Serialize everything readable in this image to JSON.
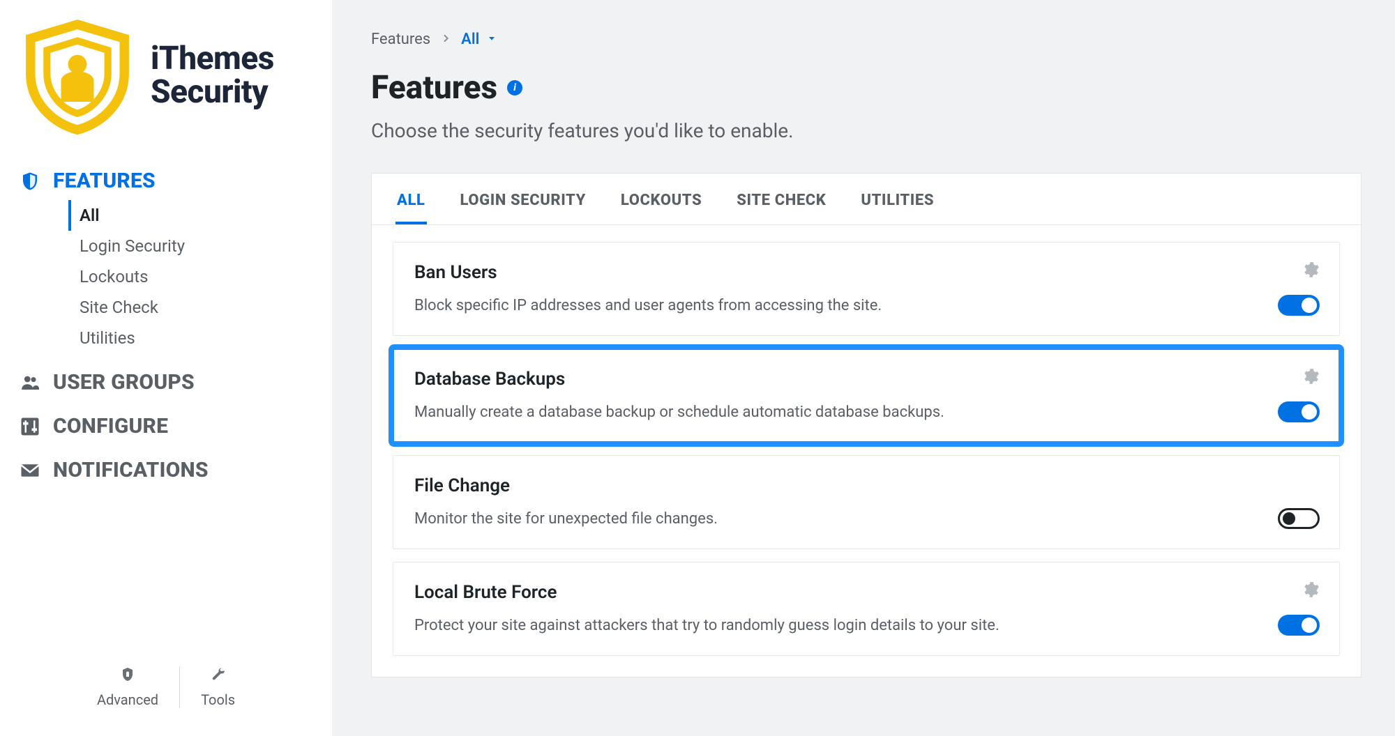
{
  "brand": {
    "line1": "iThemes",
    "line2": "Security"
  },
  "sidebar": {
    "items": [
      {
        "label": "FEATURES",
        "active": true
      },
      {
        "label": "USER GROUPS",
        "active": false
      },
      {
        "label": "CONFIGURE",
        "active": false
      },
      {
        "label": "NOTIFICATIONS",
        "active": false
      }
    ],
    "features_sub": [
      {
        "label": "All",
        "active": true
      },
      {
        "label": "Login Security",
        "active": false
      },
      {
        "label": "Lockouts",
        "active": false
      },
      {
        "label": "Site Check",
        "active": false
      },
      {
        "label": "Utilities",
        "active": false
      }
    ],
    "tools": {
      "advanced": "Advanced",
      "tools": "Tools"
    }
  },
  "breadcrumb": {
    "root": "Features",
    "current": "All"
  },
  "header": {
    "title": "Features",
    "description": "Choose the security features you'd like to enable."
  },
  "tabs": [
    {
      "label": "ALL",
      "active": true
    },
    {
      "label": "LOGIN SECURITY",
      "active": false
    },
    {
      "label": "LOCKOUTS",
      "active": false
    },
    {
      "label": "SITE CHECK",
      "active": false
    },
    {
      "label": "UTILITIES",
      "active": false
    }
  ],
  "features": [
    {
      "title": "Ban Users",
      "description": "Block specific IP addresses and user agents from accessing the site.",
      "enabled": true,
      "has_settings": true,
      "highlight": false
    },
    {
      "title": "Database Backups",
      "description": "Manually create a database backup or schedule automatic database backups.",
      "enabled": true,
      "has_settings": true,
      "highlight": true
    },
    {
      "title": "File Change",
      "description": "Monitor the site for unexpected file changes.",
      "enabled": false,
      "has_settings": false,
      "highlight": false
    },
    {
      "title": "Local Brute Force",
      "description": "Protect your site against attackers that try to randomly guess login details to your site.",
      "enabled": true,
      "has_settings": true,
      "highlight": false
    }
  ],
  "colors": {
    "accent": "#0071e3",
    "highlight": "#1e90ff"
  }
}
